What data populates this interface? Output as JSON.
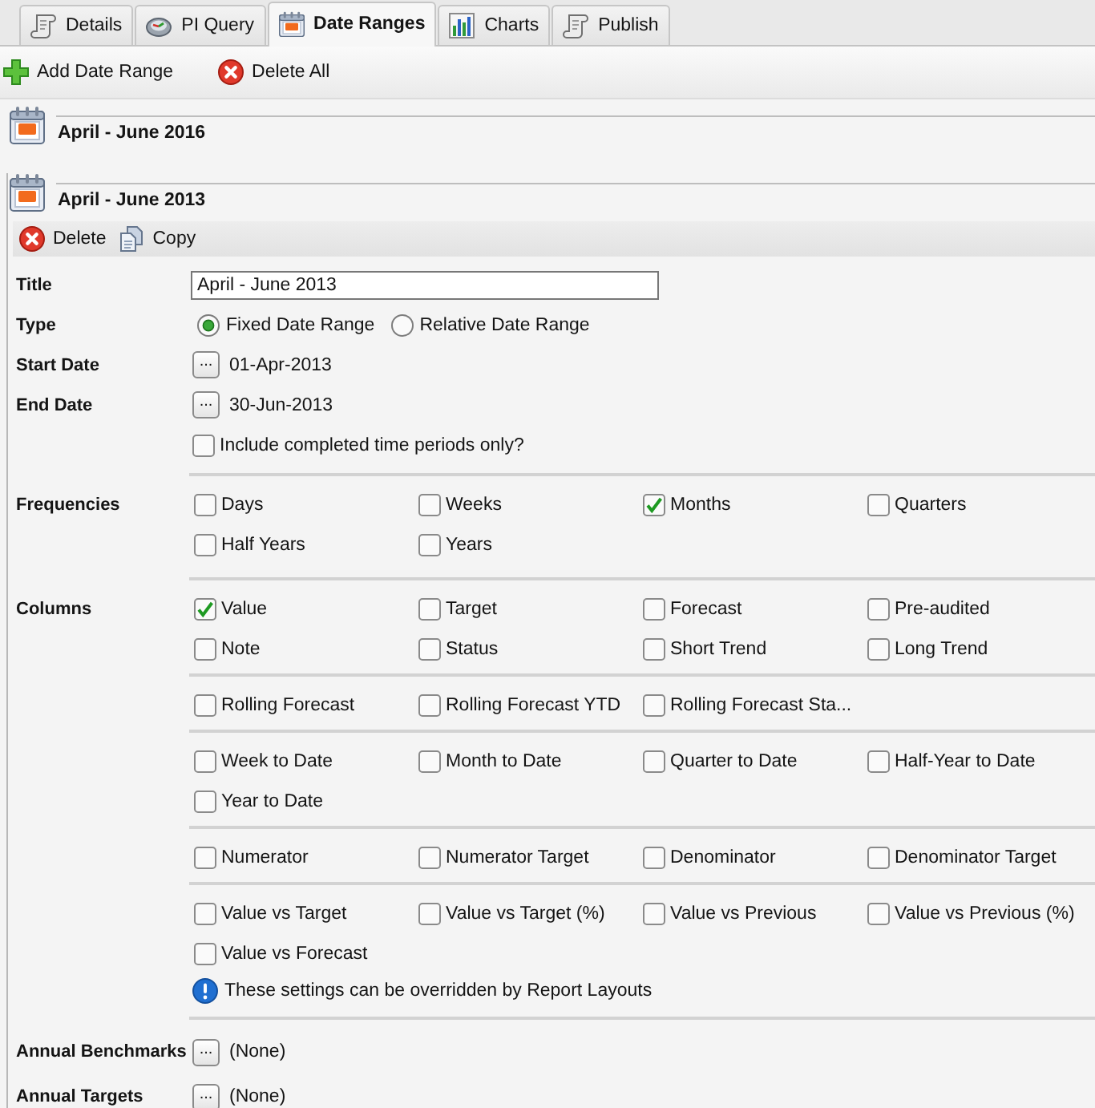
{
  "tabs": [
    {
      "label": "Details",
      "kind": "scroll",
      "selected": false
    },
    {
      "label": "PI Query",
      "kind": "dish",
      "selected": false
    },
    {
      "label": "Date Ranges",
      "kind": "calendar",
      "selected": true
    },
    {
      "label": "Charts",
      "kind": "chart",
      "selected": false
    },
    {
      "label": "Publish",
      "kind": "scroll",
      "selected": false
    }
  ],
  "toolbar": [
    {
      "label": "Add Date Range",
      "kind": "add"
    },
    {
      "label": "Delete All",
      "kind": "delete"
    }
  ],
  "date_ranges": [
    {
      "title": "April - June 2016",
      "expanded": false
    },
    {
      "title": "April - June 2013",
      "expanded": true,
      "actions": [
        {
          "label": "Delete",
          "kind": "delete"
        },
        {
          "label": "Copy",
          "kind": "copy"
        }
      ],
      "sections": [
        {
          "rows": [
            {
              "kind": "text",
              "label": "Title",
              "value": "April - June 2013"
            },
            {
              "kind": "radio",
              "label": "Type",
              "options": [
                {
                  "label": "Fixed Date Range",
                  "selected": true
                },
                {
                  "label": "Relative Date Range",
                  "selected": false
                }
              ]
            },
            {
              "kind": "picker",
              "label": "Start Date",
              "button": "...",
              "value": "01-Apr-2013"
            },
            {
              "kind": "picker",
              "label": "End Date",
              "button": "...",
              "value": "30-Jun-2013"
            },
            {
              "kind": "check",
              "text": "Include completed time periods only?",
              "checked": false
            }
          ]
        },
        {
          "rows": [
            {
              "kind": "checks",
              "label": "Frequencies",
              "groups": [
                [
                  {
                    "label": "Days",
                    "checked": false
                  },
                  {
                    "label": "Weeks",
                    "checked": false
                  },
                  {
                    "label": "Months",
                    "checked": true
                  },
                  {
                    "label": "Quarters",
                    "checked": false
                  },
                  {
                    "label": "Half Years",
                    "checked": false
                  },
                  {
                    "label": "Years",
                    "checked": false
                  }
                ]
              ]
            }
          ]
        },
        {
          "rows": [
            {
              "kind": "checks",
              "label": "Columns",
              "groups": [
                [
                  {
                    "label": "Value",
                    "checked": true
                  },
                  {
                    "label": "Target",
                    "checked": false
                  },
                  {
                    "label": "Forecast",
                    "checked": false
                  },
                  {
                    "label": "Pre-audited",
                    "checked": false
                  },
                  {
                    "label": "Note",
                    "checked": false
                  },
                  {
                    "label": "Status",
                    "checked": false
                  },
                  {
                    "label": "Short Trend",
                    "checked": false
                  },
                  {
                    "label": "Long Trend",
                    "checked": false
                  }
                ],
                [
                  {
                    "label": "Rolling Forecast",
                    "checked": false
                  },
                  {
                    "label": "Rolling Forecast YTD",
                    "checked": false
                  },
                  {
                    "label": "Rolling Forecast Sta...",
                    "checked": false
                  }
                ],
                [
                  {
                    "label": "Week to Date",
                    "checked": false
                  },
                  {
                    "label": "Month to Date",
                    "checked": false
                  },
                  {
                    "label": "Quarter to Date",
                    "checked": false
                  },
                  {
                    "label": "Half-Year to Date",
                    "checked": false
                  },
                  {
                    "label": "Year to Date",
                    "checked": false
                  }
                ],
                [
                  {
                    "label": "Numerator",
                    "checked": false
                  },
                  {
                    "label": "Numerator Target",
                    "checked": false
                  },
                  {
                    "label": "Denominator",
                    "checked": false
                  },
                  {
                    "label": "Denominator Target",
                    "checked": false
                  }
                ],
                [
                  {
                    "label": "Value vs Target",
                    "checked": false
                  },
                  {
                    "label": "Value vs Target (%)",
                    "checked": false
                  },
                  {
                    "label": "Value vs Previous",
                    "checked": false
                  },
                  {
                    "label": "Value vs Previous (%)",
                    "checked": false
                  },
                  {
                    "label": "Value vs Forecast",
                    "checked": false
                  }
                ]
              ],
              "note": "These settings can be overridden by Report Layouts"
            }
          ]
        },
        {
          "rows": [
            {
              "kind": "picker",
              "label": "Annual Benchmarks",
              "button": "...",
              "value": "(None)"
            },
            {
              "kind": "picker",
              "label": "Annual Targets",
              "button": "...",
              "value": "(None)"
            }
          ]
        }
      ]
    }
  ]
}
